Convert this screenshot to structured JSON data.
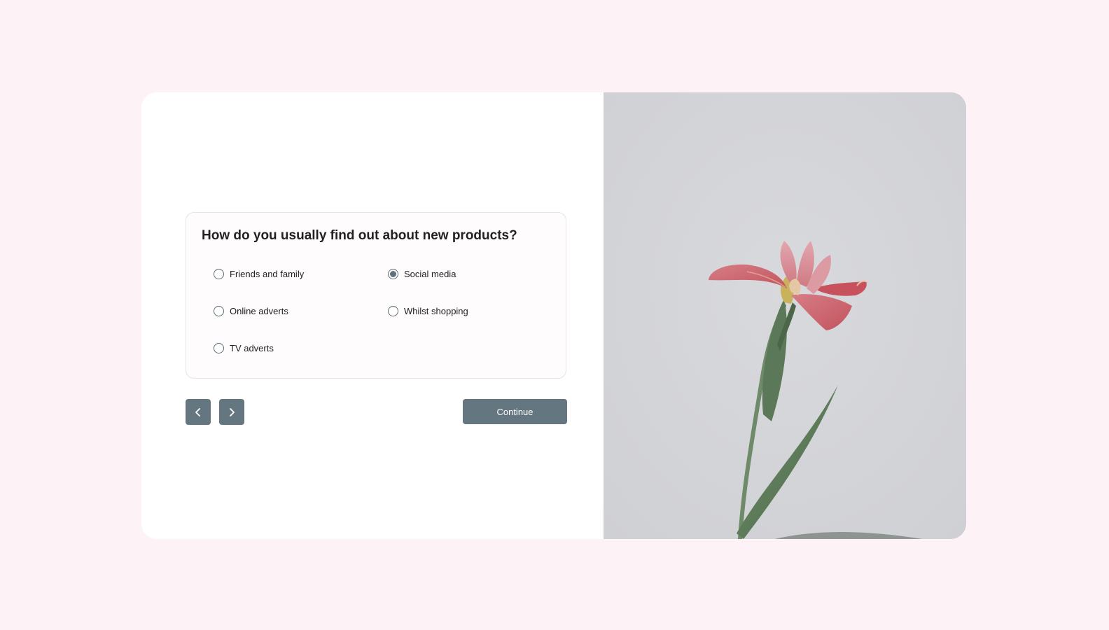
{
  "survey": {
    "question": "How do you usually find out about new products?",
    "options": [
      {
        "label": "Friends and family",
        "selected": false
      },
      {
        "label": "Social media",
        "selected": true
      },
      {
        "label": "Online adverts",
        "selected": false
      },
      {
        "label": "Whilst shopping",
        "selected": false
      },
      {
        "label": "TV adverts",
        "selected": false
      }
    ]
  },
  "nav": {
    "prev_icon": "chevron-left-icon",
    "next_icon": "chevron-right-icon",
    "continue_label": "Continue"
  },
  "image": {
    "subject": "flower-photo"
  },
  "colors": {
    "page_background": "#fdf2f5",
    "button": "#647680",
    "photo_background": "#d4d5d9"
  }
}
